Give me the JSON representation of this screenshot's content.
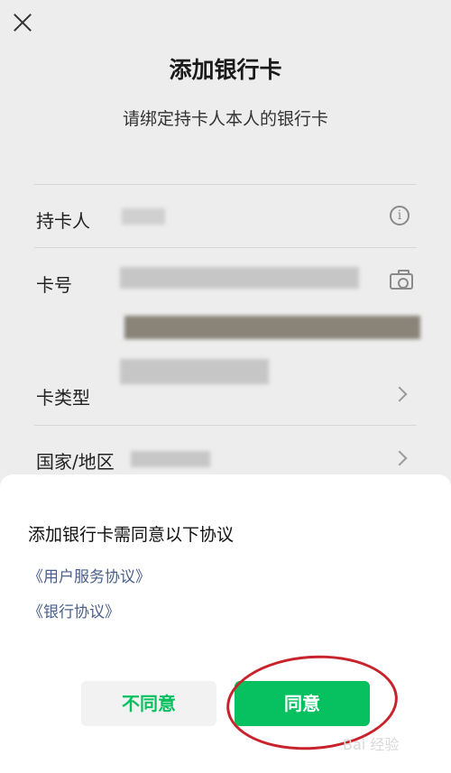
{
  "header": {
    "title": "添加银行卡",
    "subtitle": "请绑定持卡人本人的银行卡"
  },
  "form": {
    "cardholder_label": "持卡人",
    "card_number_label": "卡号",
    "card_type_label": "卡类型",
    "region_label": "国家/地区"
  },
  "icons": {
    "close": "close-icon",
    "info": "info-icon",
    "camera": "camera-icon",
    "chevron": "chevron-right-icon"
  },
  "dialog": {
    "title": "添加银行卡需同意以下协议",
    "agreements": [
      "《用户服务协议》",
      "《银行协议》"
    ],
    "disagree_label": "不同意",
    "agree_label": "同意"
  },
  "watermark": "Bai 经验",
  "colors": {
    "accent_green": "#07c160",
    "link_blue": "#4a5f8a",
    "annotation_red": "#c8232b"
  }
}
